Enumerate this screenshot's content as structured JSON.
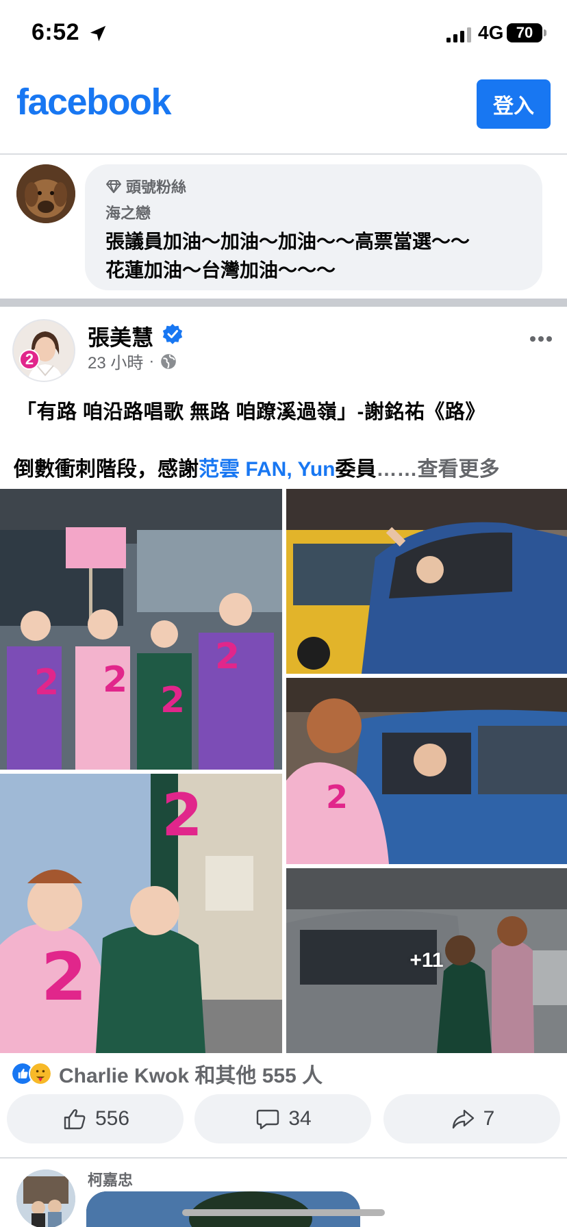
{
  "status_bar": {
    "time": "6:52",
    "network": "4G",
    "battery": "70"
  },
  "header": {
    "logo": "facebook",
    "login_label": "登入"
  },
  "comment": {
    "badge": "頭號粉絲",
    "author": "海之戀",
    "text_line1": "張議員加油～加油～加油～～高票當選～～",
    "text_line2": "花蓮加油～台灣加油～～～"
  },
  "post": {
    "author": "張美慧",
    "avatar_badge": "2",
    "time": "23 小時",
    "separator": "·",
    "text_line1": "「有路 咱沿路唱歌 無路 咱蹽溪過嶺」-謝銘祐《路》",
    "text_line2_prefix": "倒數衝刺階段，感謝 ",
    "mention": "范雲  FAN, Yun",
    "text_line2_suffix": "委員",
    "ellipsis": "……",
    "see_more": "查看更多",
    "more_photos": "+11"
  },
  "reactions": {
    "summary": "Charlie Kwok 和其他 555 人"
  },
  "actions": {
    "likes": "556",
    "comments": "34",
    "shares": "7"
  },
  "next_comment": {
    "author": "柯嘉忠"
  },
  "colors": {
    "brand": "#1877f2",
    "mention": "#1877f2",
    "badge_pink": "#e1268b"
  }
}
